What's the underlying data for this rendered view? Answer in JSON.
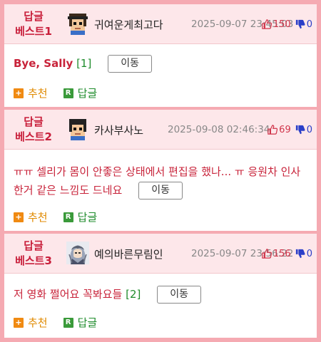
{
  "comments": [
    {
      "rank_line1": "답글",
      "rank_line2": "베스트1",
      "nickname": "귀여운게최고다",
      "date": "2025-09-07 23:45:03",
      "upvotes": "150",
      "downvotes": "0",
      "text": "Bye, Sally",
      "reply_count": "[1]",
      "move_label": "이동",
      "recommend_label": "추천",
      "reply_label": "답글",
      "avatar_icon": "pixel-face-cap-icon"
    },
    {
      "rank_line1": "답글",
      "rank_line2": "베스트2",
      "nickname": "카사부사노",
      "date": "2025-09-08 02:46:34",
      "upvotes": "69",
      "downvotes": "0",
      "text": "ㅠㅠ 셀리가 몸이 안좋은 상태에서 편집을 했나... ㅠ 응원차 인사한거 같은 느낌도 드네요",
      "reply_count": "",
      "move_label": "이동",
      "recommend_label": "추천",
      "reply_label": "답글",
      "avatar_icon": "pixel-face-icon"
    },
    {
      "rank_line1": "답글",
      "rank_line2": "베스트3",
      "nickname": "예의바른무림인",
      "date": "2025-09-07 23:56:22",
      "upvotes": "156",
      "downvotes": "0",
      "text": "저 영화 쩔어요 꼭봐요들",
      "reply_count": "[2]",
      "move_label": "이동",
      "recommend_label": "추천",
      "reply_label": "답글",
      "avatar_icon": "anime-character-icon"
    }
  ],
  "colors": {
    "page_bg": "#f5aab2",
    "header_bg": "#fde7ea",
    "rank_text": "#c81e3a",
    "comment_text": "#c8233a",
    "reply_count": "#1f8c2c",
    "upvote": "#d0344a",
    "downvote": "#2b3fc8"
  }
}
